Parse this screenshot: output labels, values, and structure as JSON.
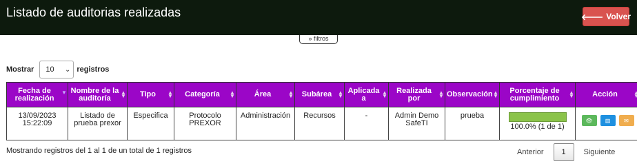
{
  "header": {
    "title": "Listado de auditorias realizadas",
    "back_label": "Volver"
  },
  "filters": {
    "label": "filtros"
  },
  "length": {
    "prefix": "Mostrar",
    "value": "10",
    "suffix": "registros"
  },
  "table": {
    "columns": [
      "Fecha de realización",
      "Nombre de la auditoría",
      "Tipo",
      "Categoría",
      "Área",
      "Subárea",
      "Aplicada a",
      "Realizada por",
      "Observación",
      "Porcentaje de cumplimiento",
      "Acción"
    ],
    "rows": [
      {
        "fecha": "13/09/2023 15:22:09",
        "nombre": "Listado de prueba prexor",
        "tipo": "Especifica",
        "categoria": "Protocolo PREXOR",
        "area": "Administración",
        "subarea": "Recursos",
        "aplicada": "-",
        "realizada": "Admin Demo SafeTI",
        "observacion": "prueba",
        "porcentaje": 1.0,
        "porcentaje_text": "100.0% (1 de 1)"
      }
    ]
  },
  "footer": {
    "info": "Mostrando registros del 1 al 1 de un total de 1 registros",
    "prev": "Anterior",
    "current": "1",
    "next": "Siguiente"
  },
  "colors": {
    "header_bg": "#0d1a0d",
    "table_header": "#9b06c7",
    "back_button": "#d9534f",
    "progress": "#8bc34a"
  },
  "icons": {
    "back": "arrow-left-icon",
    "filters": "double-chevron-down-icon",
    "view": "eye-icon",
    "chart": "bar-chart-icon",
    "mail": "envelope-icon"
  }
}
